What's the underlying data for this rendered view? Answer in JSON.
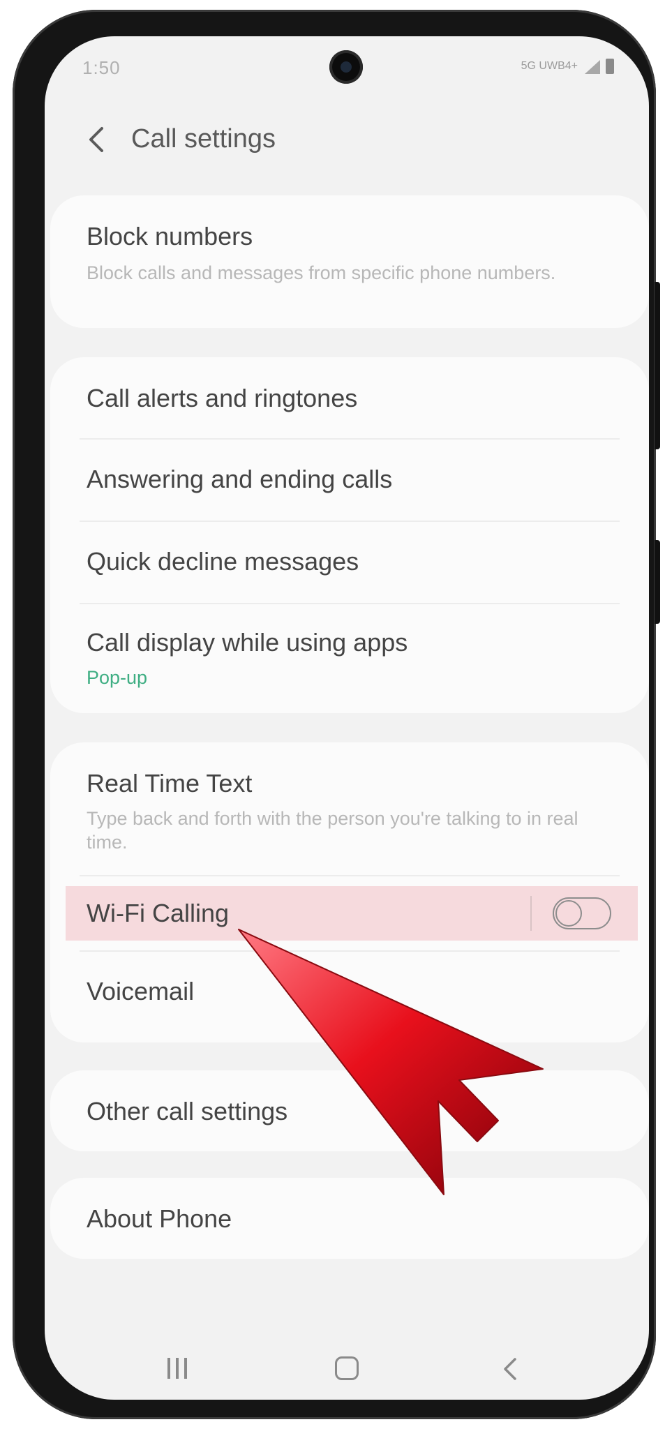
{
  "status_bar": {
    "time": "1:50",
    "network": "5G UWB4+"
  },
  "header": {
    "title": "Call settings"
  },
  "groups": [
    {
      "items": [
        {
          "label": "Block numbers",
          "sub": "Block calls and messages from specific phone numbers."
        }
      ]
    },
    {
      "items": [
        {
          "label": "Call alerts and ringtones"
        },
        {
          "label": "Answering and ending calls"
        },
        {
          "label": "Quick decline messages"
        },
        {
          "label": "Call display while using apps",
          "sub": "Pop-up"
        }
      ]
    },
    {
      "items": [
        {
          "label": "Real Time Text",
          "sub": "Type back and forth with the person you're talking to in real time."
        },
        {
          "label": "Wi-Fi Calling",
          "toggle": false,
          "highlighted": true
        },
        {
          "label": "Voicemail"
        }
      ]
    },
    {
      "items": [
        {
          "label": "Other call settings"
        }
      ]
    },
    {
      "items": [
        {
          "label": "About Phone"
        }
      ]
    }
  ],
  "nav_bar": {
    "icons": [
      "recent-apps-icon",
      "home-icon",
      "back-icon"
    ]
  },
  "colors": {
    "accent_green": "#3fae83",
    "highlight": "#f6dadd",
    "pointer_arrow": "#e8101c"
  }
}
